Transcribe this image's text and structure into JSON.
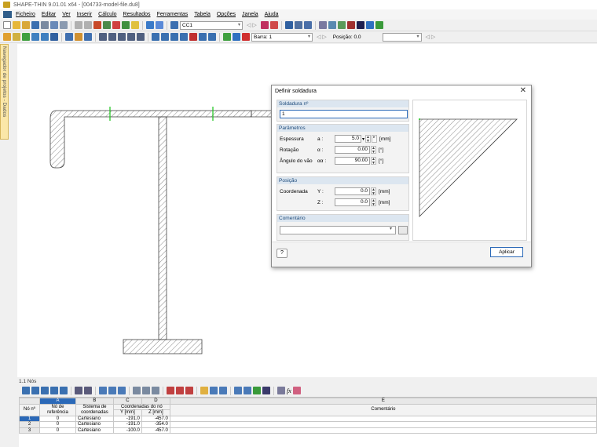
{
  "window": {
    "title": "SHAPE-THIN 9.01.01 x64 - [004733-model-file.du8]"
  },
  "menu": [
    "Ficheiro",
    "Editar",
    "Ver",
    "Inserir",
    "Cálculo",
    "Resultados",
    "Ferramentas",
    "Tabela",
    "Opções",
    "Janela",
    "Ajuda"
  ],
  "toolbar": {
    "loadcase_value": "CC1",
    "bar_value": "Barra: 1",
    "position_value": "Posição: 0.0"
  },
  "navigator": {
    "label": "Navegador de projetos - Dados"
  },
  "dialog": {
    "title": "Definir soldadura",
    "weld_no_header": "Soldadura nº",
    "weld_no_value": "1",
    "params_header": "Parâmetros",
    "thickness_label": "Espessura",
    "thickness_sym": "a :",
    "thickness_value": "5.0",
    "thickness_unit": "[mm]",
    "rotation_label": "Rotação",
    "rotation_sym": "α :",
    "rotation_value": "0.00",
    "rotation_unit": "[°]",
    "gap_label": "Ângulo do vão",
    "gap_sym": "αα :",
    "gap_value": "90.00",
    "gap_unit": "[°]",
    "position_header": "Posição",
    "coord_label": "Coordenada",
    "y_sym": "Y :",
    "y_value": "0.0",
    "y_unit": "[mm]",
    "z_sym": "Z :",
    "z_value": "0.0",
    "z_unit": "[mm]",
    "comment_header": "Comentário",
    "comment_value": "",
    "apply_label": "Aplicar"
  },
  "table_panel": {
    "title": "1.1 Nós",
    "col_letters": [
      "A",
      "B",
      "C",
      "D",
      "E"
    ],
    "headers": {
      "no": "Nó nº",
      "ref": "Nó de referência",
      "system": "Sistema de coordenadas",
      "coords": "Coordenadas do nó",
      "y": "Y [mm]",
      "z": "Z [mm]",
      "comment": "Comentário"
    },
    "rows": [
      {
        "no": "1",
        "ref": "0",
        "system": "Cartesiano",
        "y": "-191.0",
        "z": "-457.0"
      },
      {
        "no": "2",
        "ref": "0",
        "system": "Cartesiano",
        "y": "-191.0",
        "z": "-354.0"
      },
      {
        "no": "3",
        "ref": "0",
        "system": "Cartesiano",
        "y": "-100.0",
        "z": "-457.0"
      }
    ]
  },
  "colors": {
    "accent": "#2b69b8",
    "weld_marker": "#19c319",
    "navigator_tab": "#fbe7a8"
  }
}
